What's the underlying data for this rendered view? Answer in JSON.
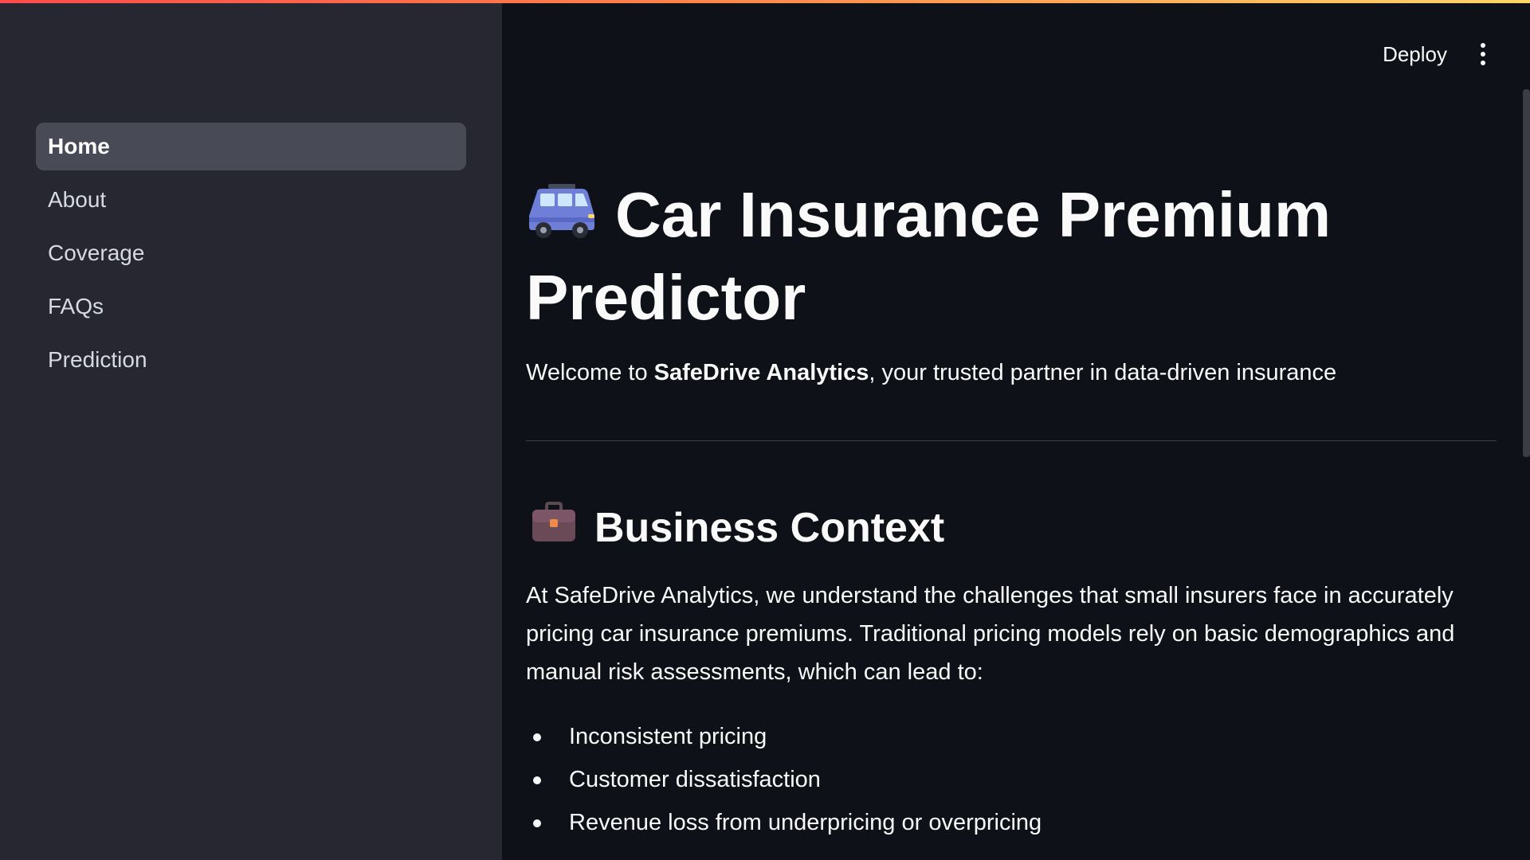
{
  "sidebar": {
    "items": [
      {
        "label": "Home",
        "active": true
      },
      {
        "label": "About",
        "active": false
      },
      {
        "label": "Coverage",
        "active": false
      },
      {
        "label": "FAQs",
        "active": false
      },
      {
        "label": "Prediction",
        "active": false
      }
    ]
  },
  "header": {
    "deploy_label": "Deploy",
    "menu_icon": "kebab-menu-icon"
  },
  "main": {
    "title_icon": "car-icon",
    "title": "Car Insurance Premium Predictor",
    "subtitle_prefix": "Welcome to ",
    "subtitle_bold": "SafeDrive Analytics",
    "subtitle_suffix": ", your trusted partner in data-driven insurance",
    "section_icon": "briefcase-icon",
    "section_title": "Business Context",
    "paragraph": "At SafeDrive Analytics, we understand the challenges that small insurers face in accurately pricing car insurance premiums. Traditional pricing models rely on basic demographics and manual risk assessments, which can lead to:",
    "bullets": [
      "Inconsistent pricing",
      "Customer dissatisfaction",
      "Revenue loss from underpricing or overpricing"
    ]
  },
  "colors": {
    "background": "#0e1117",
    "sidebar": "#262730",
    "active_nav": "#484a56",
    "accent_gradient_start": "#ff4b4b",
    "accent_gradient_end": "#fdd56a"
  }
}
